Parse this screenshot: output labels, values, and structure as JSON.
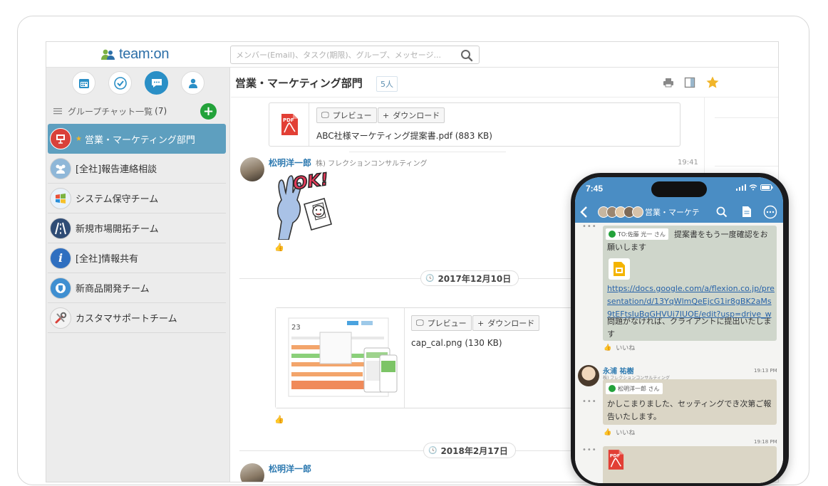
{
  "app": {
    "logo_text": "team:on"
  },
  "search": {
    "placeholder": "メンバー(Email)、タスク(期限)、グループ、メッセージ..."
  },
  "sidebar": {
    "group_list_label": "グループチャット一覧",
    "group_count": "(7)",
    "groups": [
      {
        "name": "営業・マーケティング部門",
        "active": true,
        "starred": true,
        "icon": "presentation-icon"
      },
      {
        "name": "[全社]報告連絡相談",
        "icon": "people-icon"
      },
      {
        "name": "システム保守チーム",
        "icon": "windows-icon"
      },
      {
        "name": "新規市場開拓チーム",
        "icon": "road-icon"
      },
      {
        "name": "[全社]情報共有",
        "icon": "info-icon"
      },
      {
        "name": "新商品開発チーム",
        "icon": "badge-icon"
      },
      {
        "name": "カスタマサポートチーム",
        "icon": "tools-icon"
      }
    ]
  },
  "room": {
    "title": "営業・マーケティング部門",
    "member_count": "5人"
  },
  "feed": {
    "attachment1": {
      "preview_label": "プレビュー",
      "download_label": "ダウンロード",
      "file_name": "ABC社様マーケティング提案書.pdf (883 KB)"
    },
    "message1": {
      "author": "松明洋一郎",
      "org": "株) フレクションコンサルティング",
      "time": "19:41",
      "sticker_text": "OK!"
    },
    "date1": "2017年12月10日",
    "attachment2": {
      "preview_label": "プレビュー",
      "download_label": "ダウンロード",
      "file_name": "cap_cal.png (130 KB)",
      "thumb_day": "23"
    },
    "date2": "2018年2月17日",
    "message2": {
      "author": "松明洋一郎"
    }
  },
  "phone": {
    "time": "7:45",
    "room_title": "営業・マーケテ",
    "msg1": {
      "to": "TO:佐藤 光一 さん",
      "text": "提案書をもう一度確認をお願いします",
      "link": "https://docs.google.com/a/flexion.co.jp/presentation/d/13YqWlmQeEjcG1ir8gBK2aMs9tEFtsIuBqGHVUi7IUOE/edit?usp=drive_web",
      "text2": "問題がなければ、クライアントに提出いたします",
      "like": "いいね"
    },
    "msg2": {
      "author": "永浦 祐樹",
      "org": "株) フレクションコンサルティング",
      "time": "19:13 PM",
      "to": "松明洋一郎 さん",
      "text": "かしこまりました、セッティングでき次第ご報告いたします。",
      "like": "いいね"
    },
    "msg3": {
      "time": "19:18 PM"
    }
  }
}
